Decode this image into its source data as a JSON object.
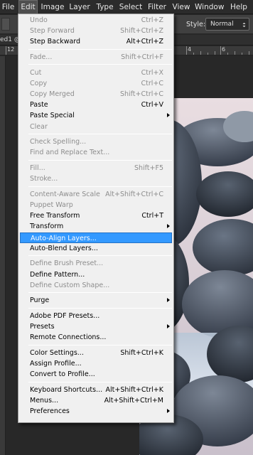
{
  "menubar": {
    "items": [
      "File",
      "Edit",
      "Image",
      "Layer",
      "Type",
      "Select",
      "Filter",
      "View",
      "Window",
      "Help"
    ],
    "active": "Edit"
  },
  "options_bar": {
    "style_label": "Style:",
    "style_value": "Normal"
  },
  "document_tab": {
    "label": "ed1 @"
  },
  "ruler": {
    "numbers": [
      "12",
      "4",
      "6"
    ]
  },
  "edit_menu": {
    "groups": [
      [
        {
          "label": "Undo",
          "shortcut": "Ctrl+Z",
          "enabled": false
        },
        {
          "label": "Step Forward",
          "shortcut": "Shift+Ctrl+Z",
          "enabled": false
        },
        {
          "label": "Step Backward",
          "shortcut": "Alt+Ctrl+Z",
          "enabled": true
        }
      ],
      [
        {
          "label": "Fade...",
          "shortcut": "Shift+Ctrl+F",
          "enabled": false
        }
      ],
      [
        {
          "label": "Cut",
          "shortcut": "Ctrl+X",
          "enabled": false
        },
        {
          "label": "Copy",
          "shortcut": "Ctrl+C",
          "enabled": false
        },
        {
          "label": "Copy Merged",
          "shortcut": "Shift+Ctrl+C",
          "enabled": false
        },
        {
          "label": "Paste",
          "shortcut": "Ctrl+V",
          "enabled": true
        },
        {
          "label": "Paste Special",
          "shortcut": "",
          "enabled": true,
          "submenu": true
        },
        {
          "label": "Clear",
          "shortcut": "",
          "enabled": false
        }
      ],
      [
        {
          "label": "Check Spelling...",
          "shortcut": "",
          "enabled": false
        },
        {
          "label": "Find and Replace Text...",
          "shortcut": "",
          "enabled": false
        }
      ],
      [
        {
          "label": "Fill...",
          "shortcut": "Shift+F5",
          "enabled": false
        },
        {
          "label": "Stroke...",
          "shortcut": "",
          "enabled": false
        }
      ],
      [
        {
          "label": "Content-Aware Scale",
          "shortcut": "Alt+Shift+Ctrl+C",
          "enabled": false
        },
        {
          "label": "Puppet Warp",
          "shortcut": "",
          "enabled": false
        },
        {
          "label": "Free Transform",
          "shortcut": "Ctrl+T",
          "enabled": true
        },
        {
          "label": "Transform",
          "shortcut": "",
          "enabled": true,
          "submenu": true
        },
        {
          "label": "Auto-Align Layers...",
          "shortcut": "",
          "enabled": true,
          "highlighted": true
        },
        {
          "label": "Auto-Blend Layers...",
          "shortcut": "",
          "enabled": true
        }
      ],
      [
        {
          "label": "Define Brush Preset...",
          "shortcut": "",
          "enabled": false
        },
        {
          "label": "Define Pattern...",
          "shortcut": "",
          "enabled": true
        },
        {
          "label": "Define Custom Shape...",
          "shortcut": "",
          "enabled": false
        }
      ],
      [
        {
          "label": "Purge",
          "shortcut": "",
          "enabled": true,
          "submenu": true
        }
      ],
      [
        {
          "label": "Adobe PDF Presets...",
          "shortcut": "",
          "enabled": true
        },
        {
          "label": "Presets",
          "shortcut": "",
          "enabled": true,
          "submenu": true
        },
        {
          "label": "Remote Connections...",
          "shortcut": "",
          "enabled": true
        }
      ],
      [
        {
          "label": "Color Settings...",
          "shortcut": "Shift+Ctrl+K",
          "enabled": true
        },
        {
          "label": "Assign Profile...",
          "shortcut": "",
          "enabled": true
        },
        {
          "label": "Convert to Profile...",
          "shortcut": "",
          "enabled": true
        }
      ],
      [
        {
          "label": "Keyboard Shortcuts...",
          "shortcut": "Alt+Shift+Ctrl+K",
          "enabled": true
        },
        {
          "label": "Menus...",
          "shortcut": "Alt+Shift+Ctrl+M",
          "enabled": true
        },
        {
          "label": "Preferences",
          "shortcut": "",
          "enabled": true,
          "submenu": true
        }
      ]
    ]
  },
  "colors": {
    "menubar_bg": "#2b2b2b",
    "menu_bg": "#f0f0f0",
    "highlight": "#3399ff",
    "disabled_text": "#8d8d8d"
  }
}
